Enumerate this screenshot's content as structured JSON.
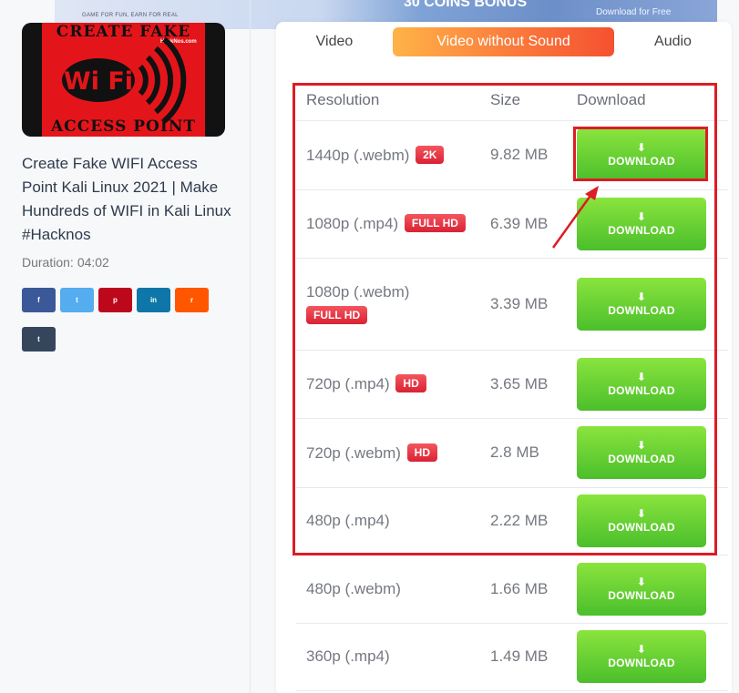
{
  "banner": {
    "tagline": "GAME FOR FUN, EARN FOR REAL",
    "coins_text": "30 COINS BONUS",
    "download_free": "Download for Free"
  },
  "video": {
    "thumbnail": {
      "top_text": "CREATE FAKE",
      "site_text": "HackNos.com",
      "wifi_text": "Wi Fi",
      "bottom_text": "ACCESS POINT"
    },
    "title": "Create Fake WIFI Access Point Kali Linux 2021 | Make Hundreds of WIFI in Kali Linux #Hacknos",
    "duration_label": "Duration:",
    "duration_value": "04:02"
  },
  "share_buttons": [
    {
      "name": "facebook",
      "glyph": "f",
      "color": "#3b5998"
    },
    {
      "name": "twitter",
      "glyph": "t",
      "color": "#55acee"
    },
    {
      "name": "pinterest",
      "glyph": "p",
      "color": "#bd081c"
    },
    {
      "name": "linkedin",
      "glyph": "in",
      "color": "#0e76a8"
    },
    {
      "name": "reddit",
      "glyph": "r",
      "color": "#ff5700"
    },
    {
      "name": "tumblr",
      "glyph": "t",
      "color": "#35465c"
    }
  ],
  "tabs": {
    "video": "Video",
    "video_no_sound": "Video without Sound",
    "audio": "Audio"
  },
  "table": {
    "headers": {
      "resolution": "Resolution",
      "size": "Size",
      "download": "Download"
    },
    "download_label": "DOWNLOAD",
    "rows": [
      {
        "resolution": "1440p (.webm)",
        "badge": "2K",
        "size": "9.82 MB"
      },
      {
        "resolution": "1080p (.mp4)",
        "badge": "FULL HD",
        "size": "6.39 MB"
      },
      {
        "resolution": "1080p (.webm)",
        "badge": "FULL HD",
        "size": "3.39 MB"
      },
      {
        "resolution": "720p (.mp4)",
        "badge": "HD",
        "size": "3.65 MB"
      },
      {
        "resolution": "720p (.webm)",
        "badge": "HD",
        "size": "2.8 MB"
      },
      {
        "resolution": "480p (.mp4)",
        "badge": "",
        "size": "2.22 MB"
      },
      {
        "resolution": "480p (.webm)",
        "badge": "",
        "size": "1.66 MB"
      },
      {
        "resolution": "360p (.mp4)",
        "badge": "",
        "size": "1.49 MB"
      }
    ]
  },
  "colors": {
    "highlight": "#dd1c26",
    "download_green": "#4bbf2c",
    "badge_red": "#d92234",
    "tab_active": "#fa7a3c"
  }
}
